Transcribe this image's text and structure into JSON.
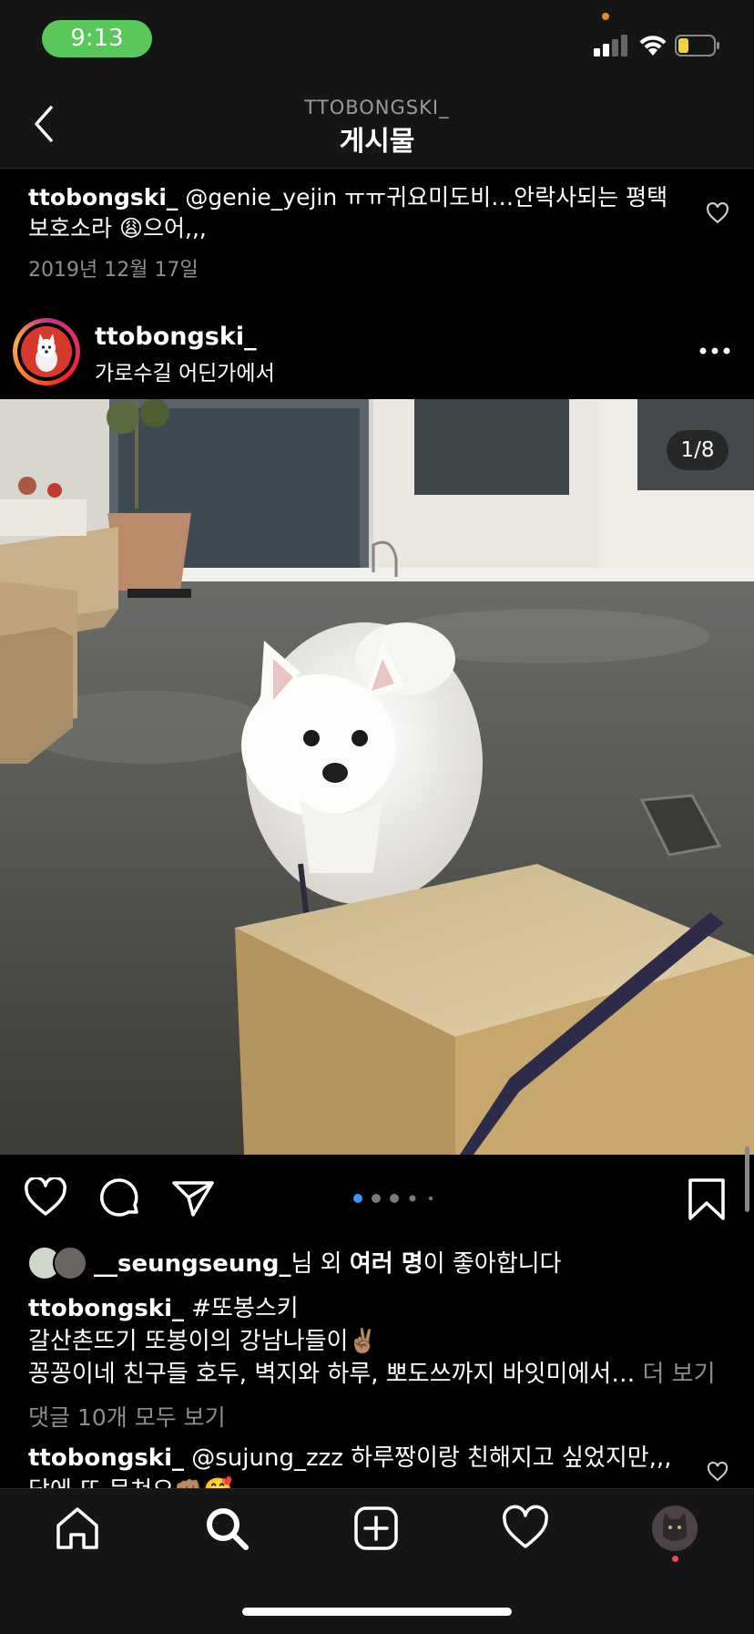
{
  "status_bar": {
    "time": "9:13"
  },
  "header": {
    "subtitle": "TTOBONGSKI_",
    "title": "게시물"
  },
  "previous_comment": {
    "username": "ttobongski_",
    "text": " @genie_yejin ㅠㅠ귀요미도비…안락사되는 평택 보호소라 😩으어,,,",
    "date": "2019년 12월 17일"
  },
  "post": {
    "username": "ttobongski_",
    "location": "가로수길 어딘가에서",
    "page_counter": "1/8",
    "carousel": {
      "total_dots": 5,
      "active_index": 0
    },
    "likes": {
      "username": "__seungseung_",
      "suffix_1": "님 외 ",
      "bold": "여러 명",
      "suffix_2": "이 좋아합니다"
    },
    "caption": {
      "username": "ttobongski_",
      "hashtag": " #또봉스키",
      "line2": "갈산촌뜨기 또봉이의 강남나들이✌🏽",
      "line3": "꽁꽁이네 친구들 호두, 벽지와 하루, 뽀도쓰까지 바잇미에서…",
      "more": " 더 보기"
    },
    "view_comments": "댓글 10개 모두 보기",
    "comment": {
      "username": "ttobongski_",
      "text": " @sujung_zzz 하루짱이랑 친해지고 싶었지만,,, 담에 또 뭉쳐요👊🏽🥰"
    }
  },
  "icons": {
    "back": "chevron-left-icon",
    "more": "more-horizontal-icon",
    "like": "heart-icon",
    "comment": "comment-icon",
    "share": "paper-plane-icon",
    "save": "bookmark-icon",
    "tabs": [
      "home-icon",
      "search-icon",
      "add-icon",
      "heart-icon",
      "profile-avatar"
    ]
  },
  "colors": {
    "background": "#000000",
    "bar": "#151515",
    "secondary_text": "#8e8e8e",
    "active_dot": "#3897f0",
    "time_pill": "#5ac75a"
  }
}
